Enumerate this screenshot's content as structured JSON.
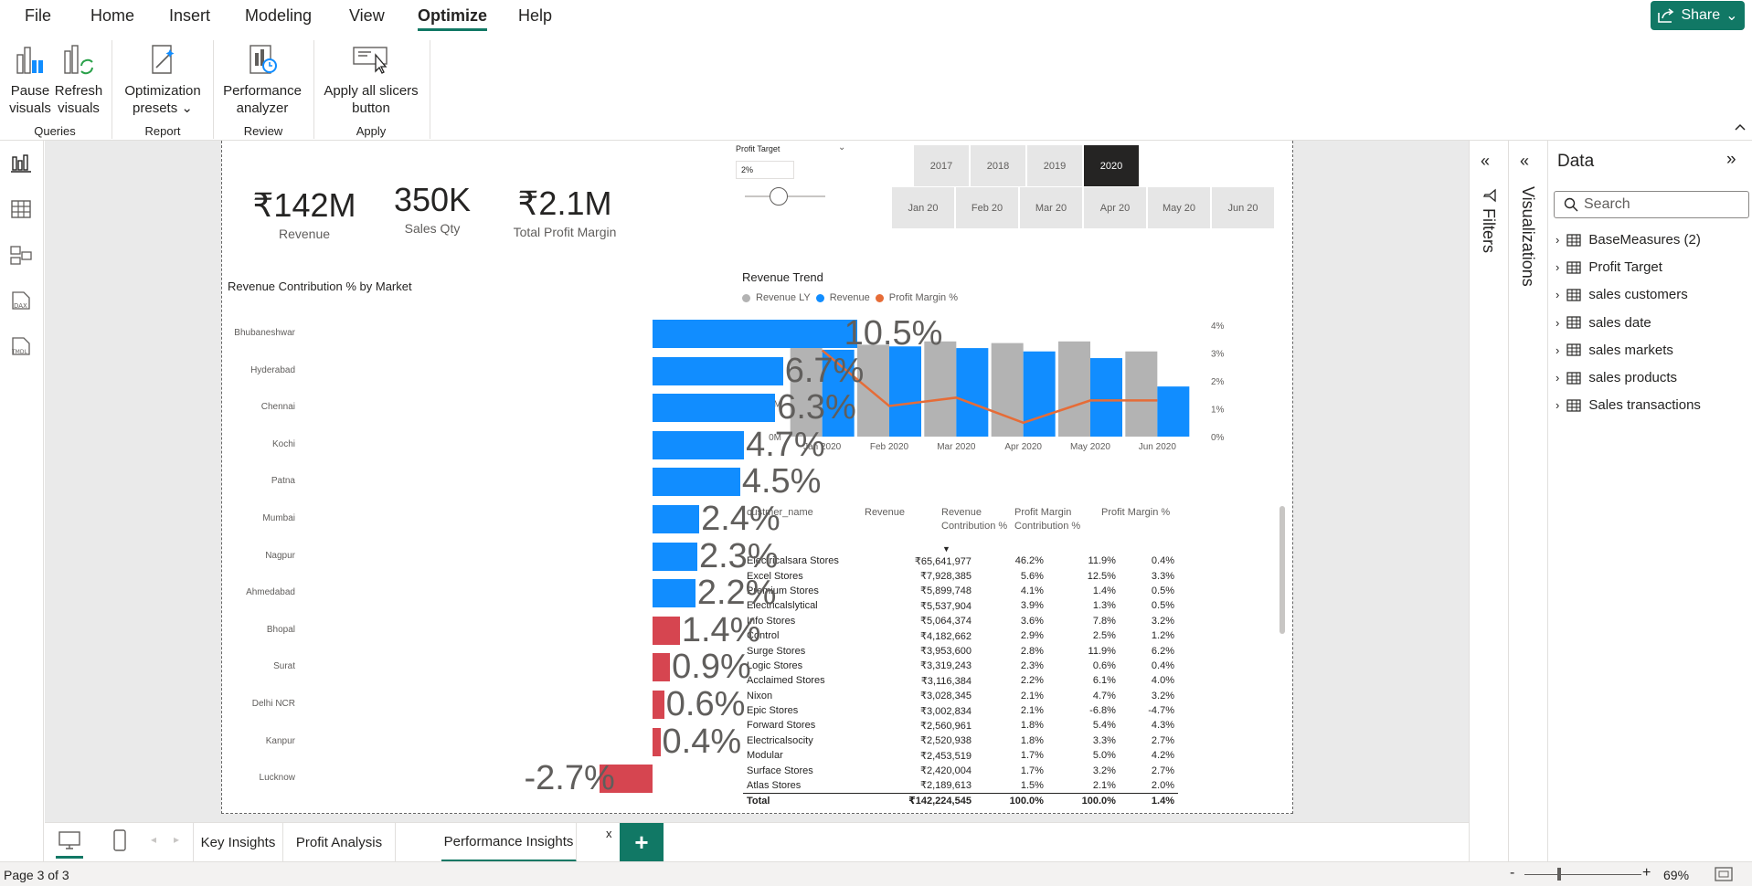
{
  "menu": {
    "items": [
      "File",
      "Home",
      "Insert",
      "Modeling",
      "View",
      "Optimize",
      "Help"
    ],
    "active": "Optimize",
    "share": "Share"
  },
  "ribbon": {
    "pause": "Pause visuals",
    "pause_l1": "Pause",
    "pause_l2": "visuals",
    "refresh_l1": "Refresh",
    "refresh_l2": "visuals",
    "opt_l1": "Optimization",
    "opt_l2": "presets",
    "perf_l1": "Performance",
    "perf_l2": "analyzer",
    "apply_l1": "Apply all slicers",
    "apply_l2": "button",
    "groups": {
      "queries": "Queries",
      "report": "Report",
      "review": "Review",
      "apply": "Apply"
    }
  },
  "kpis": [
    {
      "value": "₹142M",
      "label": "Revenue"
    },
    {
      "value": "350K",
      "label": "Sales Qty"
    },
    {
      "value": "₹2.1M",
      "label": "Total Profit Margin"
    }
  ],
  "profit_target": {
    "title": "Profit Target",
    "value": "2%",
    "slider_fraction": 0.5
  },
  "year_slicer": {
    "options": [
      "2017",
      "2018",
      "2019",
      "2020"
    ],
    "selected": "2020"
  },
  "month_slicer": {
    "options": [
      "Jan 20",
      "Feb 20",
      "Mar 20",
      "Apr 20",
      "May 20",
      "Jun 20"
    ]
  },
  "bar_chart": {
    "title": "Revenue Contribution % by Market",
    "colors": {
      "positive": "#118dff",
      "negative": "#d64550"
    },
    "markets": [
      {
        "name": "Bhubaneshwar",
        "value": 10.5,
        "label": "10.5%"
      },
      {
        "name": "Hyderabad",
        "value": 6.7,
        "label": "6.7%"
      },
      {
        "name": "Chennai",
        "value": 6.3,
        "label": "6.3%"
      },
      {
        "name": "Kochi",
        "value": 4.7,
        "label": "4.7%"
      },
      {
        "name": "Patna",
        "value": 4.5,
        "label": "4.5%"
      },
      {
        "name": "Mumbai",
        "value": 2.4,
        "label": "2.4%"
      },
      {
        "name": "Nagpur",
        "value": 2.3,
        "label": "2.3%"
      },
      {
        "name": "Ahmedabad",
        "value": 2.2,
        "label": "2.2%"
      },
      {
        "name": "Bhopal",
        "value": 1.4,
        "label": "1.4%"
      },
      {
        "name": "Surat",
        "value": 0.9,
        "label": "0.9%"
      },
      {
        "name": "Delhi NCR",
        "value": 0.6,
        "label": "0.6%"
      },
      {
        "name": "Kanpur",
        "value": 0.4,
        "label": "0.4%"
      },
      {
        "name": "Lucknow",
        "value": -2.7,
        "label": "-2.7%"
      }
    ]
  },
  "chart_data": {
    "type": "bar",
    "title": "Revenue Trend",
    "categories": [
      "Jan 2020",
      "Feb 2020",
      "Mar 2020",
      "Apr 2020",
      "May 2020",
      "Jun 2020"
    ],
    "series": [
      {
        "name": "Revenue LY",
        "values": [
          32,
          27.5,
          28.5,
          28,
          28.5,
          25.5
        ],
        "color": "#b3b3b3"
      },
      {
        "name": "Revenue",
        "values": [
          26,
          27,
          26.5,
          25.5,
          23.5,
          15
        ],
        "color": "#118dff"
      },
      {
        "name": "Profit Margin %",
        "values": [
          3.1,
          1.1,
          1.4,
          0.5,
          1.3,
          1.3
        ],
        "color": "#e66c37",
        "axis": "right",
        "type": "line"
      }
    ],
    "ylim": [
      0,
      35
    ],
    "yticks": [
      "0M",
      "10M",
      "20M",
      "30M"
    ],
    "y2lim": [
      0,
      4.2
    ],
    "y2ticks": [
      "0%",
      "1%",
      "2%",
      "3%",
      "4%"
    ]
  },
  "matrix": {
    "headers": [
      "custmer_name",
      "Revenue",
      "Revenue Contribution %",
      "Profit Margin Contribution %",
      "Profit Margin %"
    ],
    "rows": [
      [
        "Electricalsara Stores",
        "₹65,641,977",
        "46.2%",
        "11.9%",
        "0.4%"
      ],
      [
        "Excel Stores",
        "₹7,928,385",
        "5.6%",
        "12.5%",
        "3.3%"
      ],
      [
        "Premium Stores",
        "₹5,899,748",
        "4.1%",
        "1.4%",
        "0.5%"
      ],
      [
        "Electricalslytical",
        "₹5,537,904",
        "3.9%",
        "1.3%",
        "0.5%"
      ],
      [
        "Info Stores",
        "₹5,064,374",
        "3.6%",
        "7.8%",
        "3.2%"
      ],
      [
        "Control",
        "₹4,182,662",
        "2.9%",
        "2.5%",
        "1.2%"
      ],
      [
        "Surge Stores",
        "₹3,953,600",
        "2.8%",
        "11.9%",
        "6.2%"
      ],
      [
        "Logic Stores",
        "₹3,319,243",
        "2.3%",
        "0.6%",
        "0.4%"
      ],
      [
        "Acclaimed Stores",
        "₹3,116,384",
        "2.2%",
        "6.1%",
        "4.0%"
      ],
      [
        "Nixon",
        "₹3,028,345",
        "2.1%",
        "4.7%",
        "3.2%"
      ],
      [
        "Epic Stores",
        "₹3,002,834",
        "2.1%",
        "-6.8%",
        "-4.7%"
      ],
      [
        "Forward Stores",
        "₹2,560,961",
        "1.8%",
        "5.4%",
        "4.3%"
      ],
      [
        "Electricalsocity",
        "₹2,520,938",
        "1.8%",
        "3.3%",
        "2.7%"
      ],
      [
        "Modular",
        "₹2,453,519",
        "1.7%",
        "5.0%",
        "4.2%"
      ],
      [
        "Surface Stores",
        "₹2,420,004",
        "1.7%",
        "3.2%",
        "2.7%"
      ],
      [
        "Atlas Stores",
        "₹2,189,613",
        "1.5%",
        "2.1%",
        "2.0%"
      ]
    ],
    "total": [
      "Total",
      "₹142,224,545",
      "100.0%",
      "100.0%",
      "1.4%"
    ]
  },
  "tabs": [
    "Key Insights",
    "Profit Analysis",
    "Performance Insights"
  ],
  "active_tab": "Performance Insights",
  "tab_close": "x",
  "add_tab": "+",
  "status": {
    "page": "Page 3 of 3",
    "zoom": "69%"
  },
  "panes": {
    "filters": "Filters",
    "visualizations": "Visualizations",
    "data_title": "Data",
    "search_placeholder": "Search"
  },
  "data_items": [
    "BaseMeasures (2)",
    "Profit Target",
    "sales customers",
    "sales date",
    "sales markets",
    "sales products",
    "Sales transactions"
  ]
}
